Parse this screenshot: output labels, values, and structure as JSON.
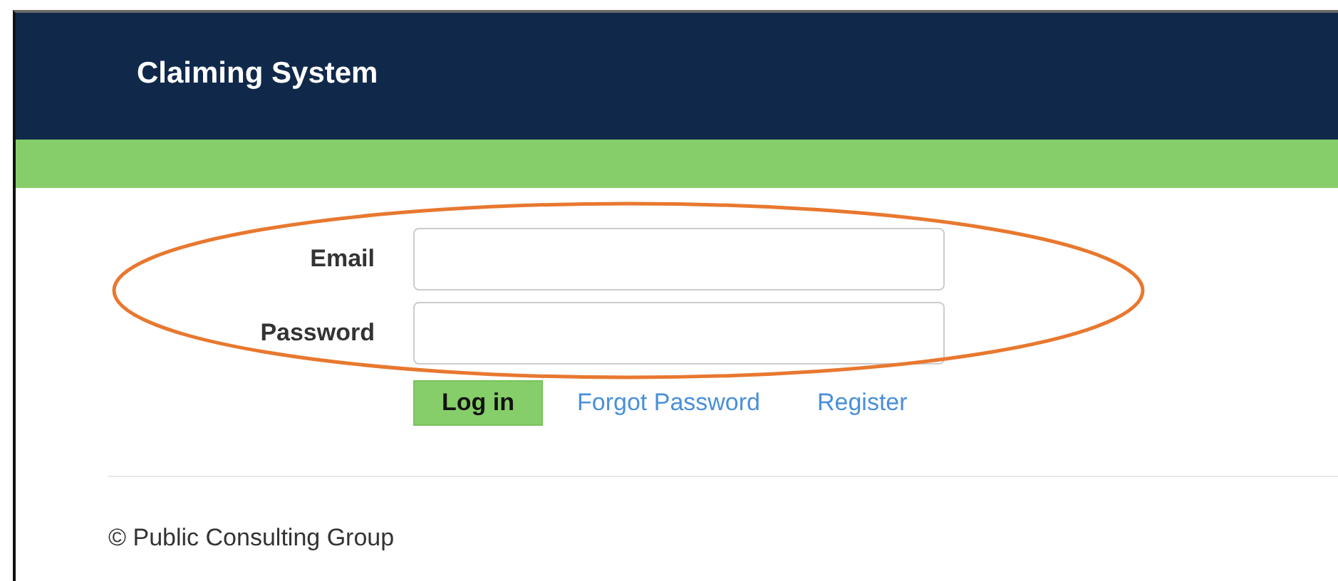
{
  "header": {
    "title": "Claiming System"
  },
  "form": {
    "fields": [
      {
        "label": "Email"
      },
      {
        "label": "Password"
      }
    ],
    "login_button": "Log in",
    "links": [
      "Forgot Password",
      "Register"
    ]
  },
  "footer": {
    "text": "© Public Consulting Group"
  }
}
